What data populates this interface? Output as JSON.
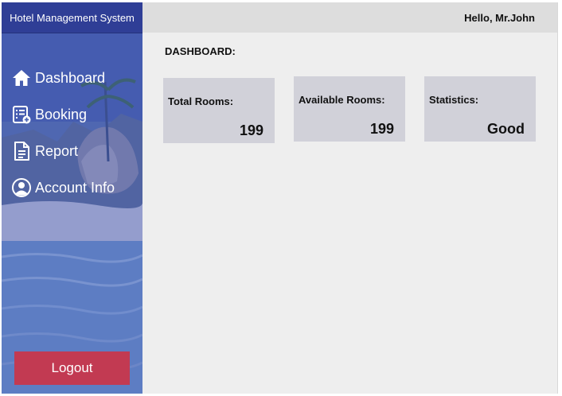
{
  "app": {
    "title": "Hotel Management System"
  },
  "header": {
    "greeting": "Hello, Mr.John"
  },
  "sidebar": {
    "items": [
      {
        "label": "Dashboard",
        "icon": "home-icon"
      },
      {
        "label": "Booking",
        "icon": "booking-list-icon"
      },
      {
        "label": "Report",
        "icon": "document-icon"
      },
      {
        "label": "Account Info",
        "icon": "user-circle-icon"
      }
    ],
    "logout_label": "Logout"
  },
  "main": {
    "title": "DASHBOARD:",
    "cards": [
      {
        "label": "Total Rooms:",
        "value": "199"
      },
      {
        "label": "Available Rooms:",
        "value": "199"
      },
      {
        "label": "Statistics:",
        "value": "Good"
      }
    ]
  },
  "colors": {
    "title_bar": "#2f3e96",
    "logout": "#c23a52",
    "card_bg": "#d1d1d9",
    "header_bg": "#dddddd",
    "content_bg": "#eeeeee"
  }
}
